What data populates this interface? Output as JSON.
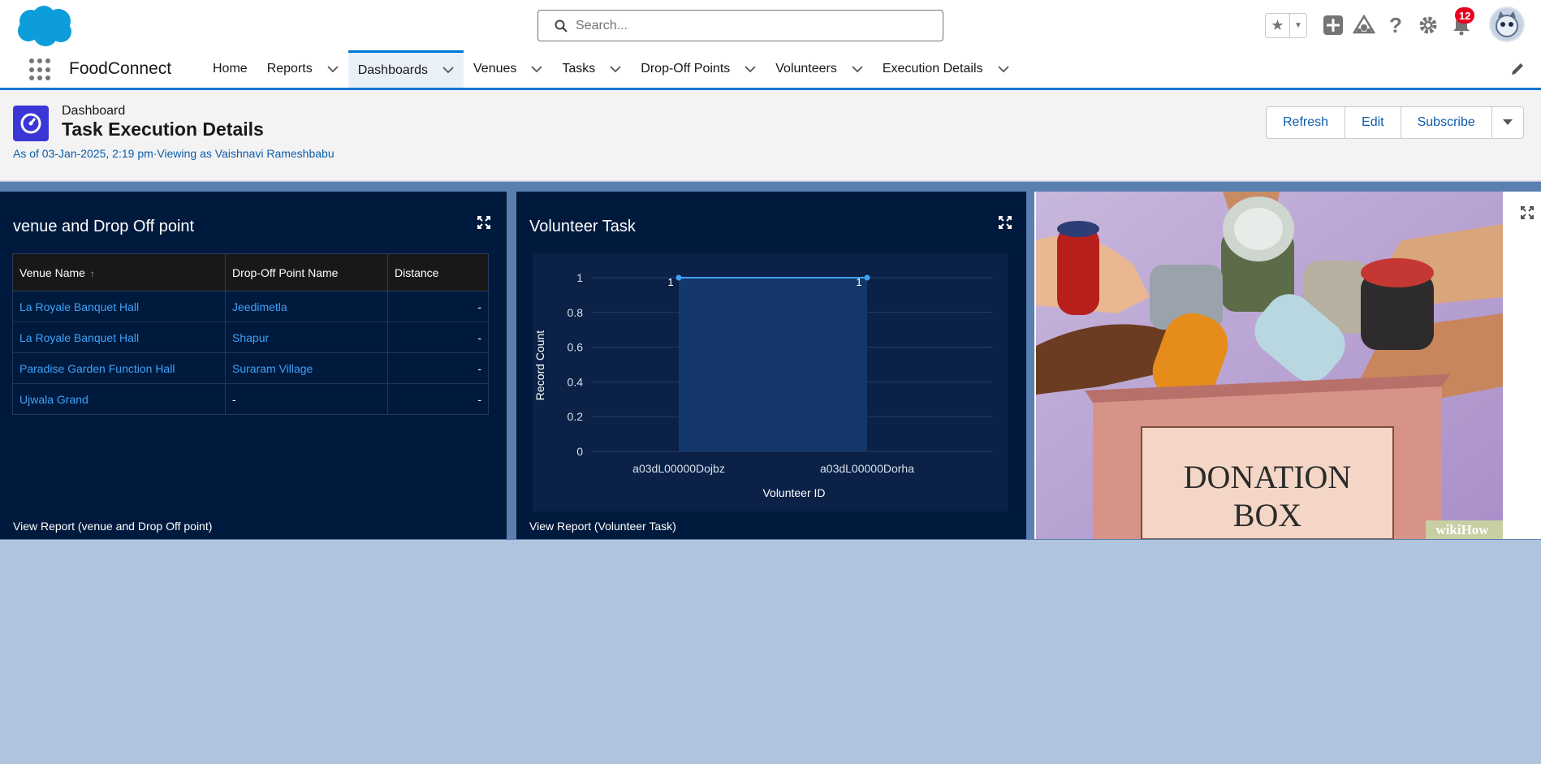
{
  "header": {
    "search_placeholder": "Search...",
    "notification_count": "12"
  },
  "nav": {
    "app_name": "FoodConnect",
    "items": [
      {
        "label": "Home",
        "has_menu": false
      },
      {
        "label": "Reports",
        "has_menu": true
      },
      {
        "label": "Dashboards",
        "has_menu": true,
        "active": true
      },
      {
        "label": "Venues",
        "has_menu": true
      },
      {
        "label": "Tasks",
        "has_menu": true
      },
      {
        "label": "Drop-Off Points",
        "has_menu": true
      },
      {
        "label": "Volunteers",
        "has_menu": true
      },
      {
        "label": "Execution Details",
        "has_menu": true
      }
    ]
  },
  "dashboard": {
    "eyebrow": "Dashboard",
    "title": "Task Execution Details",
    "meta": "As of 03-Jan-2025, 2:19 pm·Viewing as Vaishnavi Rameshbabu",
    "buttons": {
      "refresh": "Refresh",
      "edit": "Edit",
      "subscribe": "Subscribe"
    },
    "accent_color": "#3b36d6"
  },
  "table_widget": {
    "title": "venue and Drop Off point",
    "columns": [
      "Venue Name",
      "Drop-Off Point Name",
      "Distance"
    ],
    "sort_indicator": "↑",
    "rows": [
      [
        "La Royale Banquet Hall",
        "Jeedimetla",
        "-"
      ],
      [
        "La Royale Banquet Hall",
        "Shapur",
        "-"
      ],
      [
        "Paradise Garden Function Hall",
        "Suraram Village",
        "-"
      ],
      [
        "Ujwala Grand",
        "-",
        "-"
      ]
    ],
    "view_report": "View Report (venue and Drop Off point)"
  },
  "chart_widget": {
    "title": "Volunteer Task",
    "view_report": "View Report (Volunteer Task)"
  },
  "chart_data": {
    "type": "line",
    "x": [
      "a03dL00000Dojbz",
      "a03dL00000Dorha"
    ],
    "series": [
      {
        "values": [
          1,
          1
        ]
      }
    ],
    "data_labels": [
      "1",
      "1"
    ],
    "xlabel": "Volunteer ID",
    "ylabel": "Record Count",
    "ylim": [
      0,
      1
    ],
    "yticks": [
      "0",
      "0.2",
      "0.4",
      "0.6",
      "0.8",
      "1"
    ],
    "grid": true,
    "line_color": "#3fa2f7"
  },
  "image_widget": {
    "box_text_line1": "DONATION",
    "box_text_line2": "BOX",
    "watermark": "wikiHow"
  }
}
